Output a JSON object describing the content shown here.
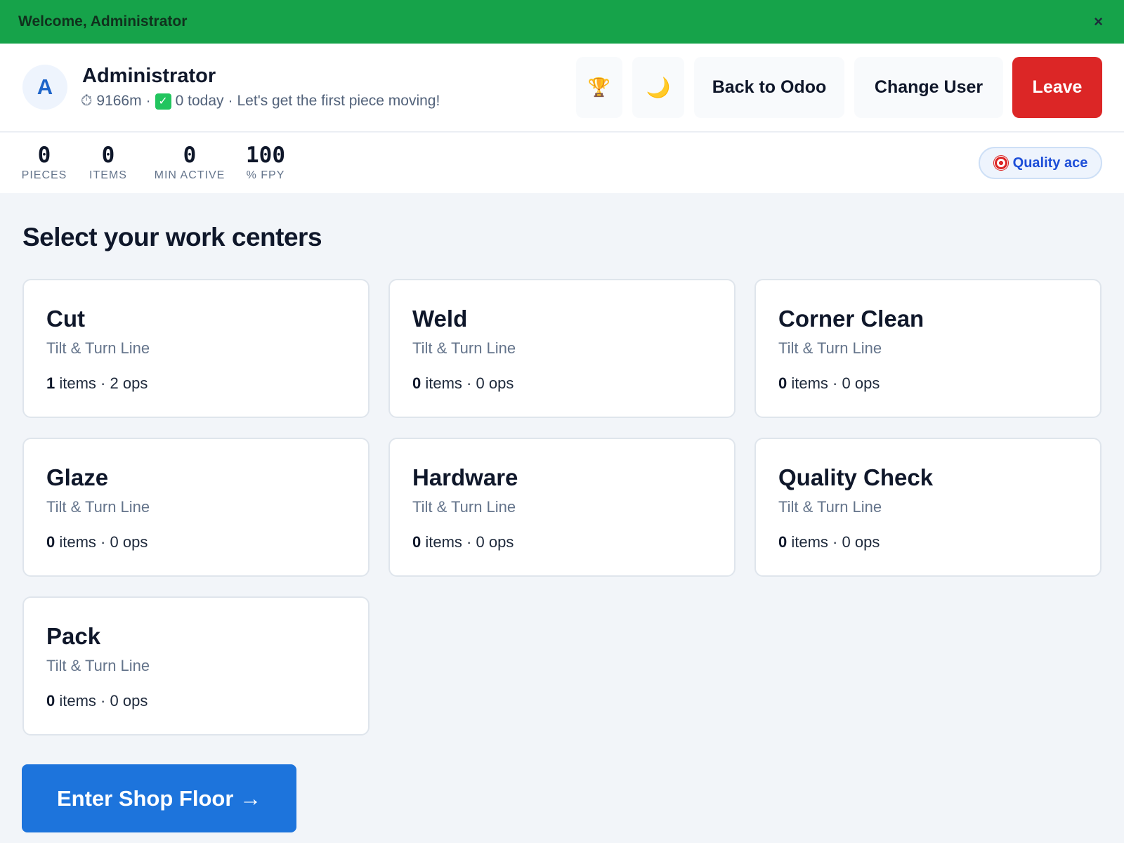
{
  "banner": {
    "text": "Welcome, Administrator",
    "close_glyph": "×"
  },
  "header": {
    "avatar_initial": "A",
    "user_name": "Administrator",
    "timer_glyph": "⏱",
    "minutes": "9166m",
    "separator": "·",
    "check_glyph": "✓",
    "today": "0 today",
    "message": "Let's get the first piece moving!",
    "trophy_glyph": "🏆",
    "moon_glyph": "🌙",
    "back_label": "Back to Odoo",
    "change_user_label": "Change User",
    "leave_label": "Leave"
  },
  "stats": {
    "pieces": {
      "value": "0",
      "label": "PIECES"
    },
    "items": {
      "value": "0",
      "label": "ITEMS"
    },
    "min_active": {
      "value": "0",
      "label": "MIN ACTIVE"
    },
    "fpy": {
      "value": "100",
      "label": "% FPY"
    },
    "badge": "Quality ace"
  },
  "section_title": "Select your work centers",
  "work_centers": [
    {
      "name": "Cut",
      "line": "Tilt & Turn Line",
      "items": "1",
      "items_label": "items",
      "ops": "2 ops"
    },
    {
      "name": "Weld",
      "line": "Tilt & Turn Line",
      "items": "0",
      "items_label": "items",
      "ops": "0 ops"
    },
    {
      "name": "Corner Clean",
      "line": "Tilt & Turn Line",
      "items": "0",
      "items_label": "items",
      "ops": "0 ops"
    },
    {
      "name": "Glaze",
      "line": "Tilt & Turn Line",
      "items": "0",
      "items_label": "items",
      "ops": "0 ops"
    },
    {
      "name": "Hardware",
      "line": "Tilt & Turn Line",
      "items": "0",
      "items_label": "items",
      "ops": "0 ops"
    },
    {
      "name": "Quality Check",
      "line": "Tilt & Turn Line",
      "items": "0",
      "items_label": "items",
      "ops": "0 ops"
    },
    {
      "name": "Pack",
      "line": "Tilt & Turn Line",
      "items": "0",
      "items_label": "items",
      "ops": "0 ops"
    }
  ],
  "enter_button": "Enter Shop Floor →",
  "colors": {
    "banner": "#16a34a",
    "leave": "#dc2626",
    "primary": "#1d74dc",
    "badge_text": "#1d4ed8"
  }
}
